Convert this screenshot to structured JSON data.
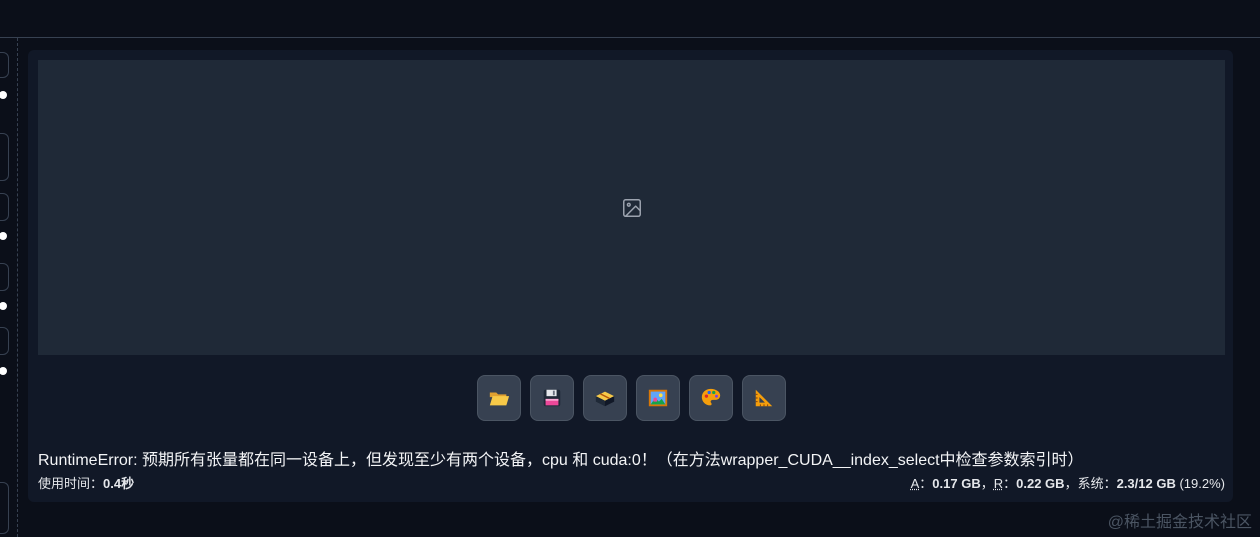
{
  "output": {
    "toolbar": [
      {
        "id": "open-folder",
        "icon": "open-folder-icon"
      },
      {
        "id": "save",
        "icon": "floppy-disk-icon"
      },
      {
        "id": "zip",
        "icon": "package-icon"
      },
      {
        "id": "send-to-img2img",
        "icon": "framed-picture-icon"
      },
      {
        "id": "send-to-inpaint",
        "icon": "artist-palette-icon"
      },
      {
        "id": "send-to-extras",
        "icon": "triangular-ruler-icon"
      }
    ],
    "error_message": "RuntimeError: 预期所有张量都在同一设备上，但发现至少有两个设备，cpu 和 cuda:0！（在方法wrapper_CUDA__index_select中检查参数索引时）",
    "time_label": "使用时间：",
    "time_value": "0.4秒",
    "memory": {
      "a_label": "A",
      "a_sep": "：",
      "a_value": "0.17 GB",
      "comma1": "，",
      "r_label": "R",
      "r_sep": "：",
      "r_value": "0.22 GB",
      "comma2": "，",
      "sys_label": "系统：",
      "sys_value": "2.3/12 GB",
      "sys_percent": " (19.2%)"
    }
  },
  "watermark": "@稀土掘金技术社区",
  "colors": {
    "background": "#0b0f19",
    "panel": "#111827",
    "image_area": "#1f2937",
    "button": "#374151"
  }
}
